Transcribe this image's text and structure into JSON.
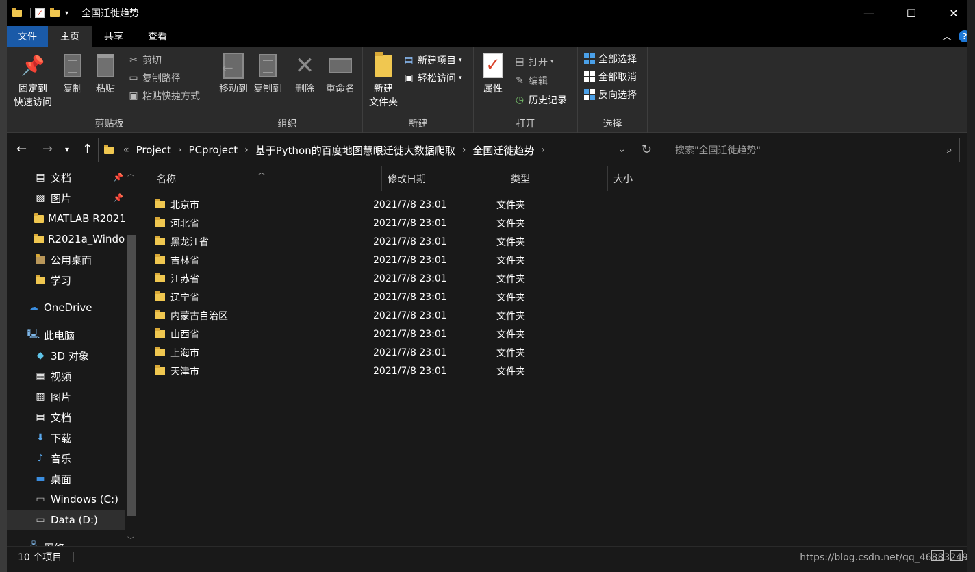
{
  "window": {
    "title": "全国迁徙趋势",
    "controls": [
      "minimize-icon",
      "maximize-icon",
      "close-icon"
    ]
  },
  "tabs": {
    "file": "文件",
    "home": "主页",
    "share": "共享",
    "view": "查看"
  },
  "ribbon": {
    "clipboard": {
      "label": "剪贴板",
      "pin": "固定到\n快速访问",
      "pin_line1": "固定到",
      "pin_line2": "快速访问",
      "copy": "复制",
      "paste": "粘贴",
      "cut": "剪切",
      "copy_path": "复制路径",
      "paste_shortcut": "粘贴快捷方式"
    },
    "organize": {
      "label": "组织",
      "move_to": "移动到",
      "copy_to": "复制到",
      "delete": "删除",
      "rename": "重命名"
    },
    "new": {
      "label": "新建",
      "new_folder_line1": "新建",
      "new_folder_line2": "文件夹",
      "new_item": "新建项目",
      "easy_access": "轻松访问"
    },
    "open": {
      "label": "打开",
      "properties": "属性",
      "open": "打开",
      "edit": "编辑",
      "history": "历史记录"
    },
    "select": {
      "label": "选择",
      "select_all": "全部选择",
      "select_none": "全部取消",
      "invert": "反向选择"
    }
  },
  "address": {
    "prefix": "«",
    "crumbs": [
      "Project",
      "PCproject",
      "基于Python的百度地图慧眼迁徙大数据爬取",
      "全国迁徙趋势"
    ],
    "search_placeholder": "搜索\"全国迁徙趋势\""
  },
  "nav_pane": {
    "items": [
      {
        "label": "文档",
        "icon": "document-icon",
        "pinned": true
      },
      {
        "label": "图片",
        "icon": "pictures-icon",
        "pinned": true
      },
      {
        "label": "MATLAB R2021",
        "icon": "folder-icon"
      },
      {
        "label": "R2021a_Windo",
        "icon": "folder-icon"
      },
      {
        "label": "公用桌面",
        "icon": "folder-icon"
      },
      {
        "label": "学习",
        "icon": "folder-icon"
      },
      {
        "label": "OneDrive",
        "icon": "cloud-icon"
      },
      {
        "label": "此电脑",
        "icon": "computer-icon"
      },
      {
        "label": "3D 对象",
        "icon": "cube-icon"
      },
      {
        "label": "视频",
        "icon": "video-icon"
      },
      {
        "label": "图片",
        "icon": "pictures-icon"
      },
      {
        "label": "文档",
        "icon": "document-icon"
      },
      {
        "label": "下载",
        "icon": "download-icon"
      },
      {
        "label": "音乐",
        "icon": "music-icon"
      },
      {
        "label": "桌面",
        "icon": "desktop-icon"
      },
      {
        "label": "Windows (C:)",
        "icon": "drive-icon"
      },
      {
        "label": "Data (D:)",
        "icon": "drive-icon",
        "selected": true
      },
      {
        "label": "网络",
        "icon": "network-icon"
      }
    ]
  },
  "file_list": {
    "columns": {
      "name": "名称",
      "date": "修改日期",
      "type": "类型",
      "size": "大小"
    },
    "rows": [
      {
        "name": "北京市",
        "date": "2021/7/8 23:01",
        "type": "文件夹"
      },
      {
        "name": "河北省",
        "date": "2021/7/8 23:01",
        "type": "文件夹"
      },
      {
        "name": "黑龙江省",
        "date": "2021/7/8 23:01",
        "type": "文件夹"
      },
      {
        "name": "吉林省",
        "date": "2021/7/8 23:01",
        "type": "文件夹"
      },
      {
        "name": "江苏省",
        "date": "2021/7/8 23:01",
        "type": "文件夹"
      },
      {
        "name": "辽宁省",
        "date": "2021/7/8 23:01",
        "type": "文件夹"
      },
      {
        "name": "内蒙古自治区",
        "date": "2021/7/8 23:01",
        "type": "文件夹"
      },
      {
        "name": "山西省",
        "date": "2021/7/8 23:01",
        "type": "文件夹"
      },
      {
        "name": "上海市",
        "date": "2021/7/8 23:01",
        "type": "文件夹"
      },
      {
        "name": "天津市",
        "date": "2021/7/8 23:01",
        "type": "文件夹"
      }
    ]
  },
  "status": {
    "count": "10 个项目",
    "divider": "|"
  },
  "watermark": "https://blog.csdn.net/qq_46883249",
  "colors": {
    "accent": "#1a5aa8",
    "folder": "#f0c750",
    "background": "#191919",
    "ribbon": "#2b2b2b"
  }
}
